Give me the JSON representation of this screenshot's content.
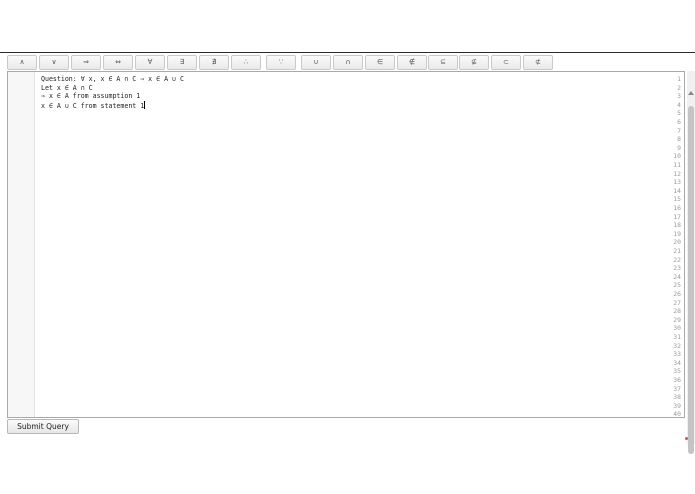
{
  "toolbar": {
    "buttons": [
      {
        "label": "∧",
        "icon": "and-symbol"
      },
      {
        "label": "∨",
        "icon": "or-symbol"
      },
      {
        "label": "⇒",
        "icon": "implies-symbol"
      },
      {
        "label": "⇔",
        "icon": "iff-symbol"
      },
      {
        "label": "∀",
        "icon": "forall-symbol"
      },
      {
        "label": "∃",
        "icon": "exists-symbol"
      },
      {
        "label": "∄",
        "icon": "not-exists-symbol"
      },
      {
        "label": "∴",
        "icon": "therefore-symbol"
      },
      {
        "label": "∵",
        "icon": "because-symbol"
      },
      {
        "label": "∪",
        "icon": "union-symbol"
      },
      {
        "label": "∩",
        "icon": "intersection-symbol"
      },
      {
        "label": "∈",
        "icon": "element-of-symbol"
      },
      {
        "label": "∉",
        "icon": "not-element-of-symbol"
      },
      {
        "label": "⊆",
        "icon": "subset-eq-symbol"
      },
      {
        "label": "⊈",
        "icon": "not-subset-eq-symbol"
      },
      {
        "label": "⊂",
        "icon": "subset-symbol"
      },
      {
        "label": "⊄",
        "icon": "not-subset-symbol"
      }
    ]
  },
  "editor": {
    "lines": [
      "Question: ∀ x, x ∈ A ∩ C ⇒ x ∈ A ∪ C",
      "Let x ∈ A ∩ C",
      "⇒ x ∈ A from assumption 1",
      "x ∈ A ∪ C from statement 1"
    ],
    "line_numbers": [
      "1",
      "2",
      "3",
      "4",
      "5",
      "6",
      "7",
      "8",
      "9",
      "10",
      "11",
      "12",
      "13",
      "14",
      "15",
      "16",
      "17",
      "18",
      "19",
      "20",
      "21",
      "22",
      "23",
      "24",
      "25",
      "26",
      "27",
      "28",
      "29",
      "30",
      "31",
      "32",
      "33",
      "34",
      "35",
      "36",
      "37",
      "38",
      "39",
      "40"
    ]
  },
  "form": {
    "submit_label": "Submit Query"
  },
  "colors": {
    "caret": "#000000",
    "resize_indicator": "#e24b4b"
  }
}
